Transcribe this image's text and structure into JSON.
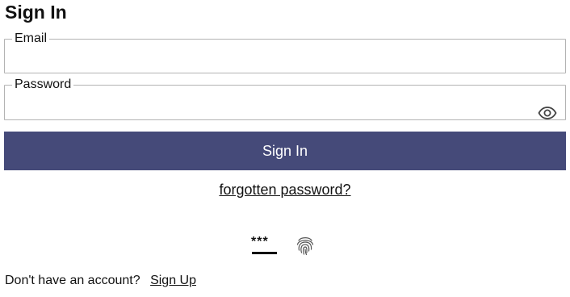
{
  "header": {
    "title": "Sign In"
  },
  "form": {
    "email": {
      "label": "Email",
      "value": "",
      "placeholder": ""
    },
    "password": {
      "label": "Password",
      "value": "",
      "placeholder": ""
    },
    "show_password_icon": "eye-icon",
    "submit_label": "Sign In",
    "forgot_label": "forgotten password?"
  },
  "alt_methods": {
    "password_method_icon": "password-stars-icon",
    "password_stars": "***",
    "fingerprint_icon": "fingerprint-icon"
  },
  "footer": {
    "prompt": "Don't have an account?",
    "signup_label": "Sign Up"
  },
  "colors": {
    "button_bg": "#454a79",
    "button_text": "#ffffff",
    "border": "#b3b3b3"
  }
}
